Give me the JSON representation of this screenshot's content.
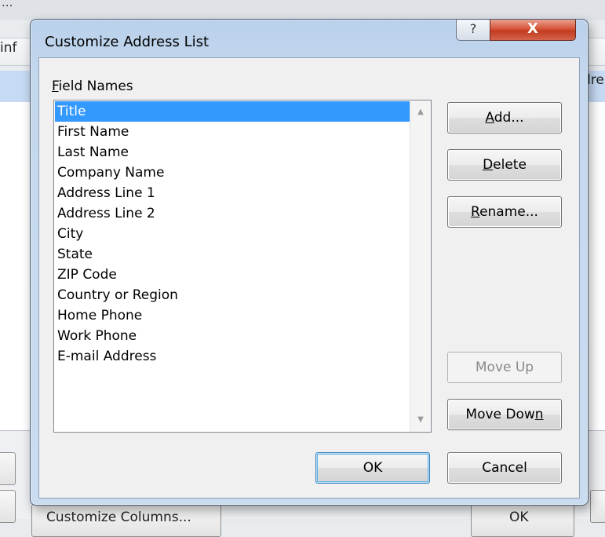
{
  "background": {
    "window_title_fragment": "...",
    "column_header_left": "inf",
    "column_header_right": "dre",
    "bottom_button_left": "Customize Columns...",
    "bottom_button_right": "OK"
  },
  "dialog": {
    "title": "Customize Address List",
    "help_glyph": "?",
    "close_glyph": "X",
    "field_names_label": {
      "mnemonic": "F",
      "rest": "ield Names"
    },
    "fields": [
      "Title",
      "First Name",
      "Last Name",
      "Company Name",
      "Address Line 1",
      "Address Line 2",
      "City",
      "State",
      "ZIP Code",
      "Country or Region",
      "Home Phone",
      "Work Phone",
      "E-mail Address"
    ],
    "selected_field": "Title",
    "buttons": {
      "add": {
        "mnemonic": "A",
        "rest": "dd..."
      },
      "delete": {
        "mnemonic": "D",
        "rest": "elete"
      },
      "rename": {
        "mnemonic": "R",
        "rest": "ename..."
      },
      "move_up": "Move Up",
      "move_down": {
        "text": "Move Dow",
        "mnemonic": "n"
      },
      "ok": "OK",
      "cancel": "Cancel"
    },
    "icons": {
      "help": "help-icon",
      "close": "close-icon",
      "scroll_up": "scroll-up-arrow-icon",
      "scroll_down": "scroll-down-arrow-icon"
    }
  }
}
